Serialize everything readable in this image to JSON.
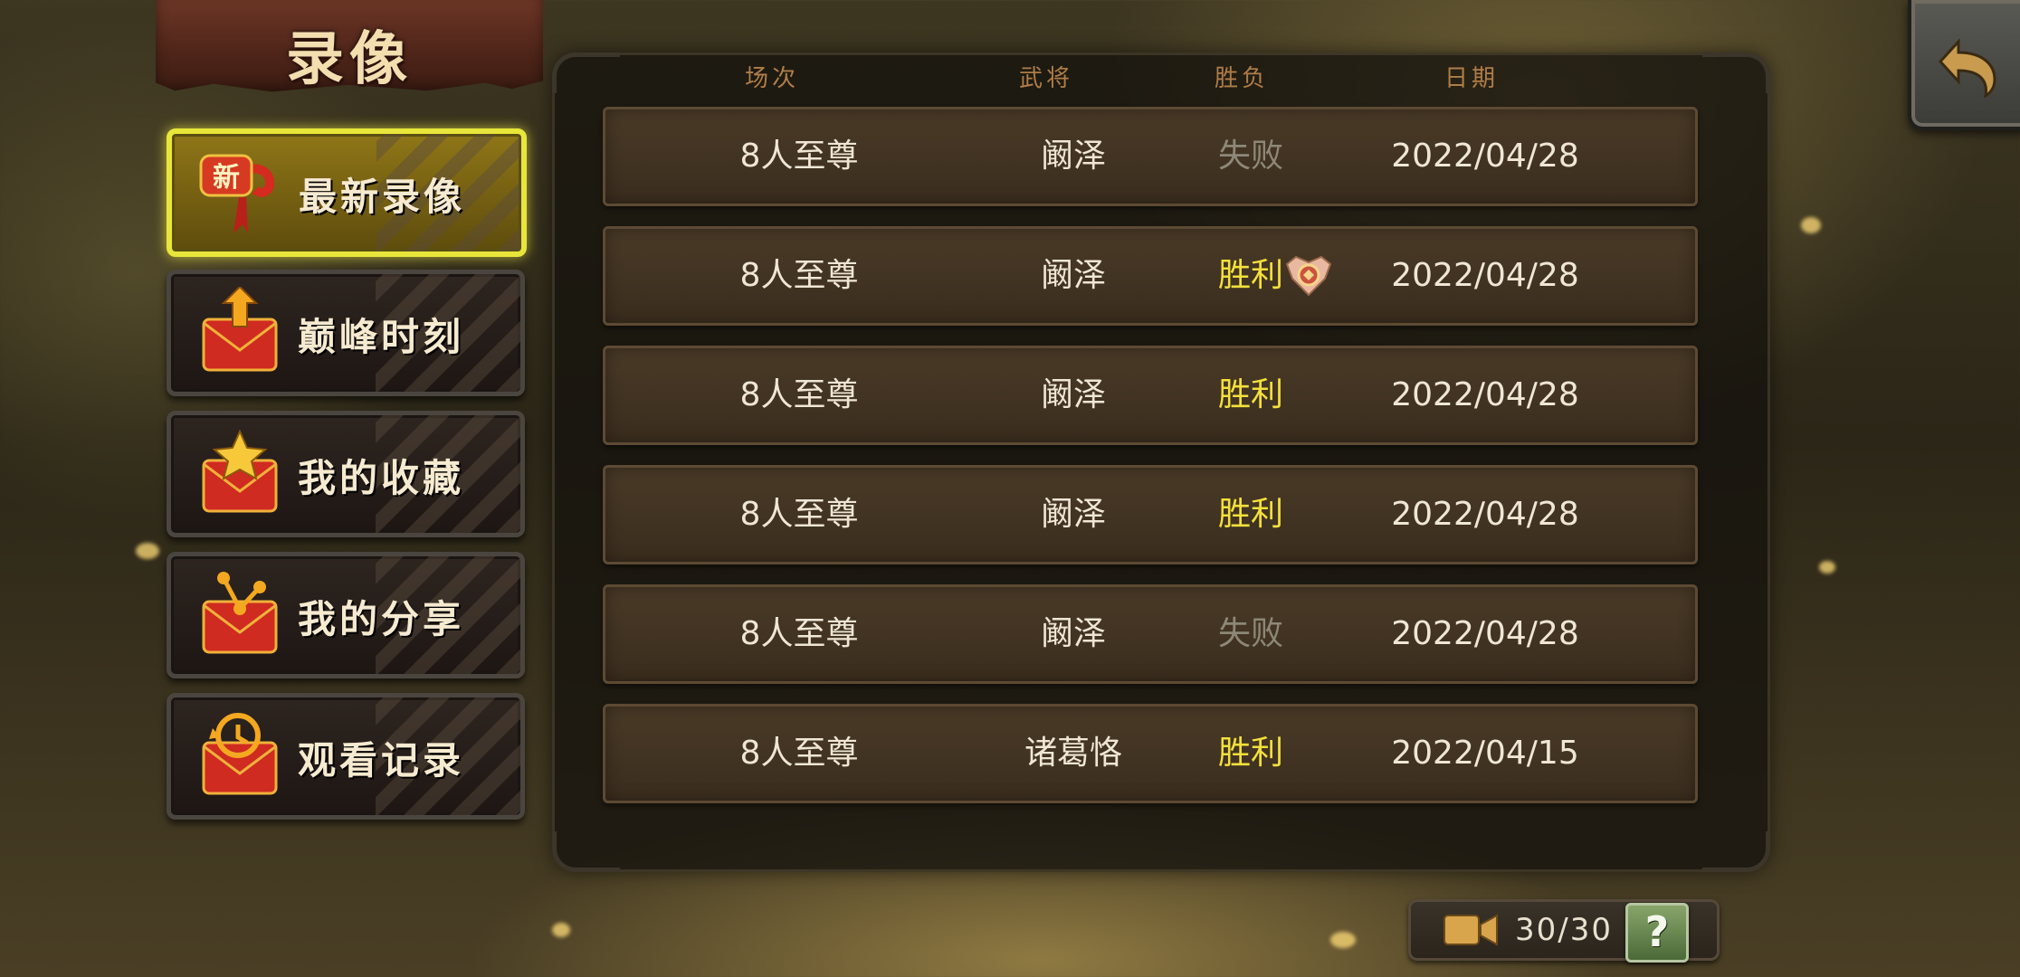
{
  "title": "录像",
  "sidebar": {
    "items": [
      {
        "label": "最新录像",
        "badge": "新",
        "icon": "new-ribbon-icon",
        "active": true
      },
      {
        "label": "巅峰时刻",
        "icon": "peak-envelope-icon",
        "active": false
      },
      {
        "label": "我的收藏",
        "icon": "star-envelope-icon",
        "active": false
      },
      {
        "label": "我的分享",
        "icon": "share-envelope-icon",
        "active": false
      },
      {
        "label": "观看记录",
        "icon": "history-envelope-icon",
        "active": false
      }
    ]
  },
  "table": {
    "headers": [
      "场次",
      "武将",
      "胜负",
      "日期"
    ],
    "rows": [
      {
        "mode": "8人至尊",
        "general": "阚泽",
        "result": "失败",
        "result_type": "lose",
        "date": "2022/04/28",
        "mvp": false
      },
      {
        "mode": "8人至尊",
        "general": "阚泽",
        "result": "胜利",
        "result_type": "win",
        "date": "2022/04/28",
        "mvp": true
      },
      {
        "mode": "8人至尊",
        "general": "阚泽",
        "result": "胜利",
        "result_type": "win",
        "date": "2022/04/28",
        "mvp": false
      },
      {
        "mode": "8人至尊",
        "general": "阚泽",
        "result": "胜利",
        "result_type": "win",
        "date": "2022/04/28",
        "mvp": false
      },
      {
        "mode": "8人至尊",
        "general": "阚泽",
        "result": "失败",
        "result_type": "lose",
        "date": "2022/04/28",
        "mvp": false
      },
      {
        "mode": "8人至尊",
        "general": "诸葛恪",
        "result": "胜利",
        "result_type": "win",
        "date": "2022/04/15",
        "mvp": false
      }
    ]
  },
  "footer": {
    "count": "30/30",
    "help_label": "?"
  },
  "colors": {
    "win": "#f3e13b",
    "lose": "#8d8878",
    "active_border": "#e8e63a",
    "header_text": "#b07d47"
  }
}
